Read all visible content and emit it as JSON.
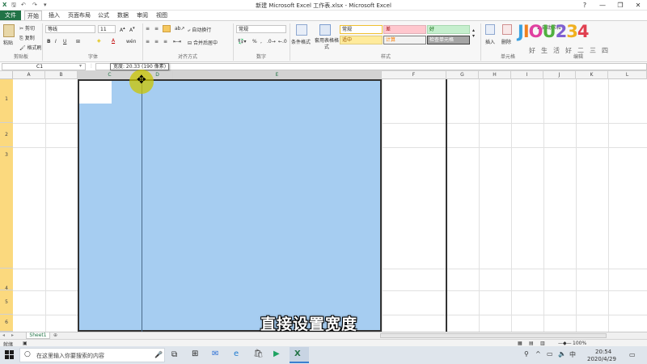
{
  "window": {
    "title": "新建 Microsoft Excel 工作表.xlsx - Microsoft Excel",
    "controls": [
      "?",
      "—",
      "❐",
      "✕"
    ]
  },
  "menu_tabs": [
    "文件",
    "开始",
    "插入",
    "页面布局",
    "公式",
    "数据",
    "审阅",
    "视图"
  ],
  "ribbon": {
    "clipboard": {
      "paste": "粘贴",
      "cut": "剪切",
      "copy": "复制",
      "format_painter": "格式刷",
      "label": "剪贴板"
    },
    "font": {
      "name": "等线",
      "size": "11",
      "label": "字体"
    },
    "alignment": {
      "wrap": "自动换行",
      "merge": "合并后居中",
      "label": "对齐方式"
    },
    "number": {
      "format": "常规",
      "label": "数字"
    },
    "styles": {
      "cond_format": "条件格式",
      "table_format": "套用表格格式",
      "cells": [
        {
          "text": "常规",
          "bg": "#ffffff",
          "border": "#f0c030",
          "color": "#222222"
        },
        {
          "text": "差",
          "bg": "#ffc7ce",
          "border": "#e0b0b8",
          "color": "#9c0006"
        },
        {
          "text": "好",
          "bg": "#c6efce",
          "border": "#a8d8b0",
          "color": "#006100"
        },
        {
          "text": "适中",
          "bg": "#ffeb9c",
          "border": "#e0cc80",
          "color": "#9c5700"
        },
        {
          "text": "计算",
          "bg": "#f2f2f2",
          "border": "#7f7f7f",
          "color": "#fa7d00"
        },
        {
          "text": "检查单元格",
          "bg": "#a5a5a5",
          "border": "#3f3f3f",
          "color": "#ffffff"
        }
      ],
      "label": "样式"
    },
    "cells_group": {
      "insert": "插入",
      "delete": "删除",
      "label": "单元格"
    },
    "editing": {
      "autosum": "自动求和",
      "label": "编辑"
    }
  },
  "formula_bar": {
    "name_box": "C1",
    "fx": "fx",
    "tooltip": "宽度: 20.33 (190 像素)"
  },
  "columns": [
    {
      "letter": "A",
      "selected": false
    },
    {
      "letter": "B",
      "selected": false
    },
    {
      "letter": "C",
      "selected": true
    },
    {
      "letter": "D",
      "selected": true
    },
    {
      "letter": "E",
      "selected": true
    },
    {
      "letter": "F",
      "selected": false
    },
    {
      "letter": "G",
      "selected": false
    },
    {
      "letter": "H",
      "selected": false
    },
    {
      "letter": "I",
      "selected": false
    },
    {
      "letter": "J",
      "selected": false
    },
    {
      "letter": "K",
      "selected": false
    },
    {
      "letter": "L",
      "selected": false
    }
  ],
  "rows": [
    "1",
    "2",
    "3",
    "4",
    "5",
    "6"
  ],
  "sheet_tab": "Sheet1",
  "status": {
    "ready": "就绪",
    "zoom": "100%"
  },
  "taskbar": {
    "search_placeholder": "在这里输入你要搜索的内容",
    "time": "20:54",
    "date": "2020/4/29"
  },
  "subtitle": "直接设置宽度",
  "watermark": {
    "letters": [
      "J",
      "I",
      "O",
      "U",
      "2",
      "3",
      "4"
    ],
    "slogan": "好生活好二三四"
  },
  "colors": {
    "excel_green": "#217346",
    "selection": "#a6cdf1",
    "row_highlight": "#fbd97e",
    "cursor_halo": "#c9c400"
  }
}
